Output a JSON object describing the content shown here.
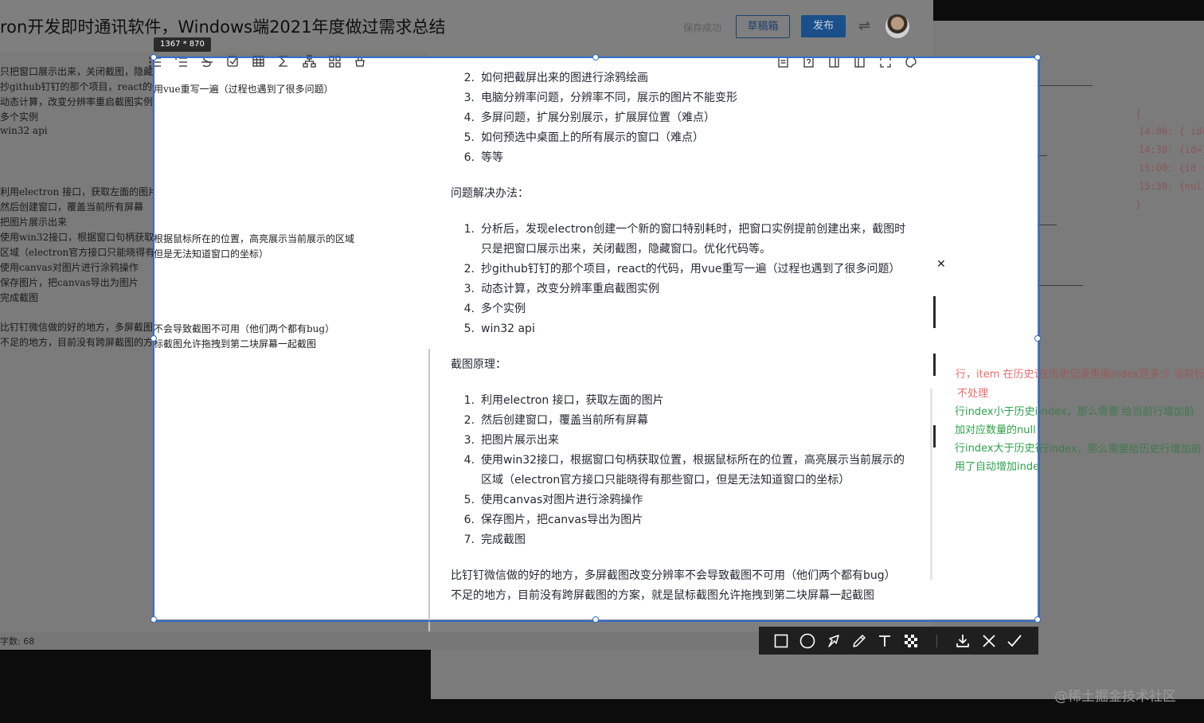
{
  "editor": {
    "title": "ron开发即时通讯软件，Windows端2021年度做过需求总结",
    "save_status": "保存成功",
    "draft_button": "草稿箱",
    "publish_button": "发布",
    "switch_icon": "swap-icon",
    "toolbar_icons_left": [
      "heading-icon",
      "quote-icon",
      "link-icon",
      "image-icon",
      "code-icon",
      "code-block-icon",
      "unordered-list-icon",
      "ordered-list-icon",
      "strikethrough-icon",
      "task-list-icon",
      "table-icon",
      "formula-icon",
      "diagram-icon",
      "grid-icon",
      "clear-icon"
    ],
    "toolbar_icons_right": [
      "outline-icon",
      "help-icon",
      "preview-only-icon",
      "split-view-icon",
      "fullscreen-icon",
      "theme-icon"
    ],
    "status": "字数: 68"
  },
  "markdown_source": {
    "dim_lines": [
      "只把窗口展示出来，关闭截图，隐藏窗口。优化代码等。",
      "抄github钉钉的那个项目，react的代码，",
      "动态计算，改变分辨率重启截图实例",
      "多个实例",
      "win32 api",
      "利用electron 接口，获取左面的图片",
      "然后创建窗口，覆盖当前所有屏幕",
      "把图片展示出来",
      "使用win32接口，根据窗口句柄获取位置，",
      "区域（electron官方接口只能晓得有那些窗口，",
      "使用canvas对图片进行涂鸦操作",
      "保存图片，把canvas导出为图片",
      "完成截图",
      "比钉钉微信做的好的地方，多屏截图改变分辨率",
      "不足的地方，目前没有跨屏截图的方案，就是鼠"
    ],
    "bright_lines": {
      "line_vue": "用vue重写一遍（过程也遇到了很多问题）",
      "line_win32": "根据鼠标所在的位置，高亮展示当前展示的区域",
      "line_electron": "但是无法知道窗口的坐标）",
      "line_bug": "不会导致截图不可用（他们两个都有bug）",
      "line_cross": "标截图允许拖拽到第二块屏幕一起截图"
    }
  },
  "preview": {
    "problems": [
      {
        "n": "2.",
        "text": "如何把截屏出来的图进行涂鸦绘画"
      },
      {
        "n": "3.",
        "text": "电脑分辨率问题，分辨率不同，展示的图片不能变形"
      },
      {
        "n": "4.",
        "text": "多屏问题，扩展分别展示，扩展屏位置（难点）"
      },
      {
        "n": "5.",
        "text": "如何预选中桌面上的所有展示的窗口（难点）"
      },
      {
        "n": "6.",
        "text": "等等"
      }
    ],
    "solutions_heading": "问题解决办法：",
    "solutions": [
      {
        "n": "1.",
        "text": "分析后，发现electron创建一个新的窗口特别耗时，把窗口实例提前创建出来，截图时",
        "cont": "只是把窗口展示出来，关闭截图，隐藏窗口。优化代码等。"
      },
      {
        "n": "2.",
        "text": "抄github钉钉的那个项目，react的代码，用vue重写一遍（过程也遇到了很多问题）"
      },
      {
        "n": "3.",
        "text": "动态计算，改变分辨率重启截图实例"
      },
      {
        "n": "4.",
        "text": "多个实例"
      },
      {
        "n": "5.",
        "text": "win32 api"
      }
    ],
    "principle_heading": "截图原理：",
    "principles": [
      {
        "n": "1.",
        "text": "利用electron 接口，获取左面的图片"
      },
      {
        "n": "2.",
        "text": "然后创建窗口，覆盖当前所有屏幕"
      },
      {
        "n": "3.",
        "text": "把图片展示出来"
      },
      {
        "n": "4.",
        "text": "使用win32接口，根据窗口句柄获取位置，根据鼠标所在的位置，高亮展示当前展示的",
        "cont": "区域（electron官方接口只能晓得有那些窗口，但是无法知道窗口的坐标）"
      },
      {
        "n": "5.",
        "text": "使用canvas对图片进行涂鸦操作"
      },
      {
        "n": "6.",
        "text": "保存图片，把canvas导出为图片"
      },
      {
        "n": "7.",
        "text": "完成截图"
      }
    ],
    "summary_good": "比钉钉微信做的好的地方，多屏截图改变分辨率不会导致截图不可用（他们两个都有bug）",
    "summary_bad": "不足的地方，目前没有跨屏截图的方案，就是鼠标截图允许拖拽到第二块屏幕一起截图"
  },
  "background_code": {
    "brace_open": "{",
    "rows": [
      "14:00: { id=",
      "14:30: {id=1,",
      "15:00: {id =3,",
      "15:30: {null, n"
    ],
    "brace_close": "}"
  },
  "background_notes": {
    "red_1": "行，item 在历史记录里面index是多少  当前行index",
    "red_2": "不处理",
    "green_1": "行index小于历史index，那么需要 给当前行增加前",
    "green_2": "加对应数量的null",
    "green_3": "行index大于历史行index，那么需要给历史行增加前",
    "green_4": "用了自动增加index"
  },
  "capture": {
    "size_label": "1367 * 870",
    "tools": [
      "rectangle-icon",
      "ellipse-icon",
      "arrow-icon",
      "pen-icon",
      "text-icon",
      "mosaic-icon"
    ],
    "actions": [
      "download-icon",
      "cancel-icon",
      "confirm-icon"
    ],
    "accent_color": "#2f6fd0"
  },
  "watermark": "@稀土掘金技术社区"
}
